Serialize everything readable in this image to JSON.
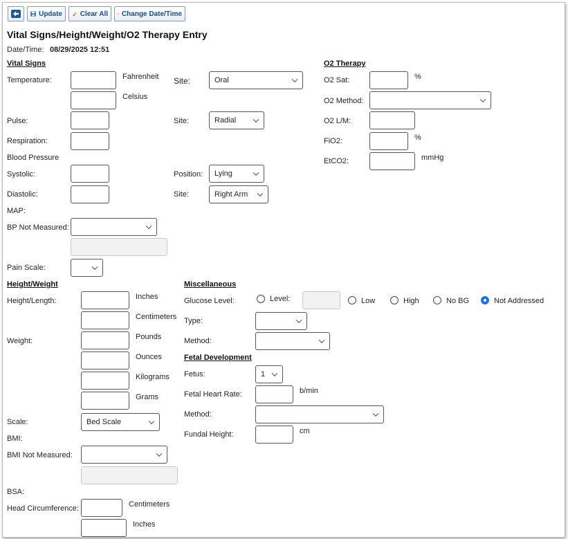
{
  "toolbar": {
    "back_label": "",
    "update_label": "Update",
    "clear_label": "Clear All",
    "change_dt_label": "Change Date/Time"
  },
  "page": {
    "title": "Vital Signs/Height/Weight/O2 Therapy Entry",
    "datetime_label": "Date/Time:",
    "datetime_value": "08/29/2025 12:51"
  },
  "vitals": {
    "header": "Vital Signs",
    "temperature_label": "Temperature:",
    "fahrenheit_unit": "Fahrenheit",
    "celsius_unit": "Celsius",
    "temp_site_label": "Site:",
    "temp_site_value": "Oral",
    "pulse_label": "Pulse:",
    "pulse_site_label": "Site:",
    "pulse_site_value": "Radial",
    "respiration_label": "Respiration:",
    "bp_label": "Blood Pressure",
    "systolic_label": "Systolic:",
    "position_label": "Position:",
    "position_value": "Lying",
    "diastolic_label": "Diastolic:",
    "bp_site_label": "Site:",
    "bp_site_value": "Right Arm",
    "map_label": "MAP:",
    "bp_not_measured_label": "BP Not Measured:",
    "bp_not_measured_value": "",
    "pain_label": "Pain Scale:",
    "pain_value": ""
  },
  "o2": {
    "header": "O2 Therapy",
    "sat_label": "O2 Sat:",
    "sat_unit": "%",
    "method_label": "O2 Method:",
    "method_value": "",
    "lm_label": "O2 L/M:",
    "fio2_label": "FiO2:",
    "fio2_unit": "%",
    "etco2_label": "EtCO2:",
    "etco2_unit": "mmHg"
  },
  "height_weight": {
    "header": "Height/Weight",
    "height_label": "Height/Length:",
    "inches_unit": "Inches",
    "centimeters_unit": "Centimeters",
    "weight_label": "Weight:",
    "pounds_unit": "Pounds",
    "ounces_unit": "Ounces",
    "kilograms_unit": "Kilograms",
    "grams_unit": "Grams",
    "scale_label": "Scale:",
    "scale_value": "Bed Scale",
    "bmi_label": "BMI:",
    "bmi_not_measured_label": "BMI Not Measured:",
    "bmi_not_measured_value": "",
    "bsa_label": "BSA:",
    "head_label": "Head Circumference:",
    "head_cm_unit": "Centimeters",
    "head_in_unit": "Inches"
  },
  "misc": {
    "header": "Miscellaneous",
    "glucose_label": "Glucose Level:",
    "level_option": "Level:",
    "low_option": "Low",
    "high_option": "High",
    "nobg_option": "No BG",
    "notaddressed_option": "Not Addressed",
    "selected_option": "Not Addressed",
    "type_label": "Type:",
    "type_value": "",
    "method_label": "Method:",
    "method_value": ""
  },
  "fetal": {
    "header": "Fetal Development",
    "fetus_label": "Fetus:",
    "fetus_value": "1",
    "hr_label": "Fetal Heart Rate:",
    "hr_unit": "b/min",
    "method_label": "Method:",
    "method_value": "",
    "fundal_label": "Fundal Height:",
    "fundal_unit": "cm"
  },
  "colors": {
    "accent": "#1a73e8",
    "toolbar_text": "#1a4c80",
    "border": "#555555"
  }
}
